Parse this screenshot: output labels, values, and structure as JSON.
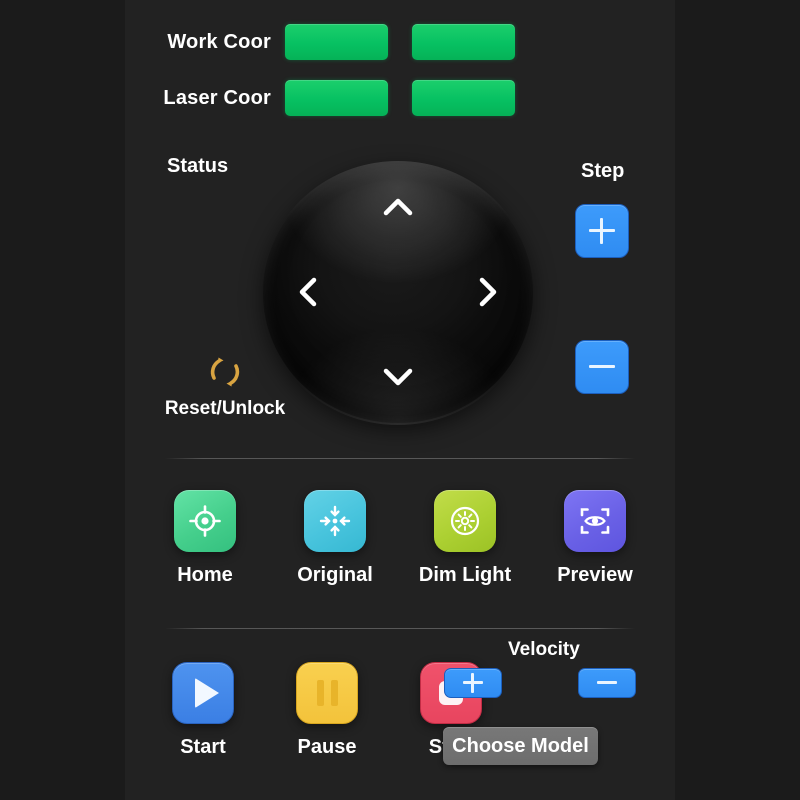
{
  "coordinates": {
    "rows": [
      {
        "label": "Work Coor",
        "field_x": "",
        "field_y": ""
      },
      {
        "label": "Laser Coor",
        "field_x": "",
        "field_y": ""
      }
    ]
  },
  "status": {
    "label": "Status",
    "value": ""
  },
  "step": {
    "label": "Step",
    "increase_label": "+",
    "decrease_label": "−"
  },
  "dpad": {
    "up_icon": "chevron-up-icon",
    "down_icon": "chevron-down-icon",
    "left_icon": "chevron-left-icon",
    "right_icon": "chevron-right-icon"
  },
  "reset": {
    "label": "Reset/Unlock",
    "icon": "refresh-circular-arrows-icon",
    "icon_color": "#d9a441"
  },
  "functions": [
    {
      "label": "Home",
      "icon": "crosshair-target-icon",
      "color": "#45cf8c"
    },
    {
      "label": "Original",
      "icon": "converge-arrows-icon",
      "color": "#48c4dd"
    },
    {
      "label": "Dim Light",
      "icon": "brightness-sun-icon",
      "color": "#acd032"
    },
    {
      "label": "Preview",
      "icon": "eye-scan-frame-icon",
      "color": "#6a61e6"
    }
  ],
  "transport": [
    {
      "label": "Start",
      "icon": "play-icon",
      "color": "#3b7fe4"
    },
    {
      "label": "Pause",
      "icon": "pause-icon",
      "color": "#f3c33b"
    },
    {
      "label": "Stop",
      "icon": "stop-icon",
      "color": "#e8455f"
    }
  ],
  "velocity": {
    "label": "Velocity",
    "increase_label": "+",
    "decrease_label": "−"
  },
  "choose_model": {
    "label": "Choose Model"
  },
  "theme": {
    "background": "#1a1a1a",
    "panel": "#222222",
    "field_green": "#07c162",
    "accent_blue": "#2f8cf2"
  }
}
